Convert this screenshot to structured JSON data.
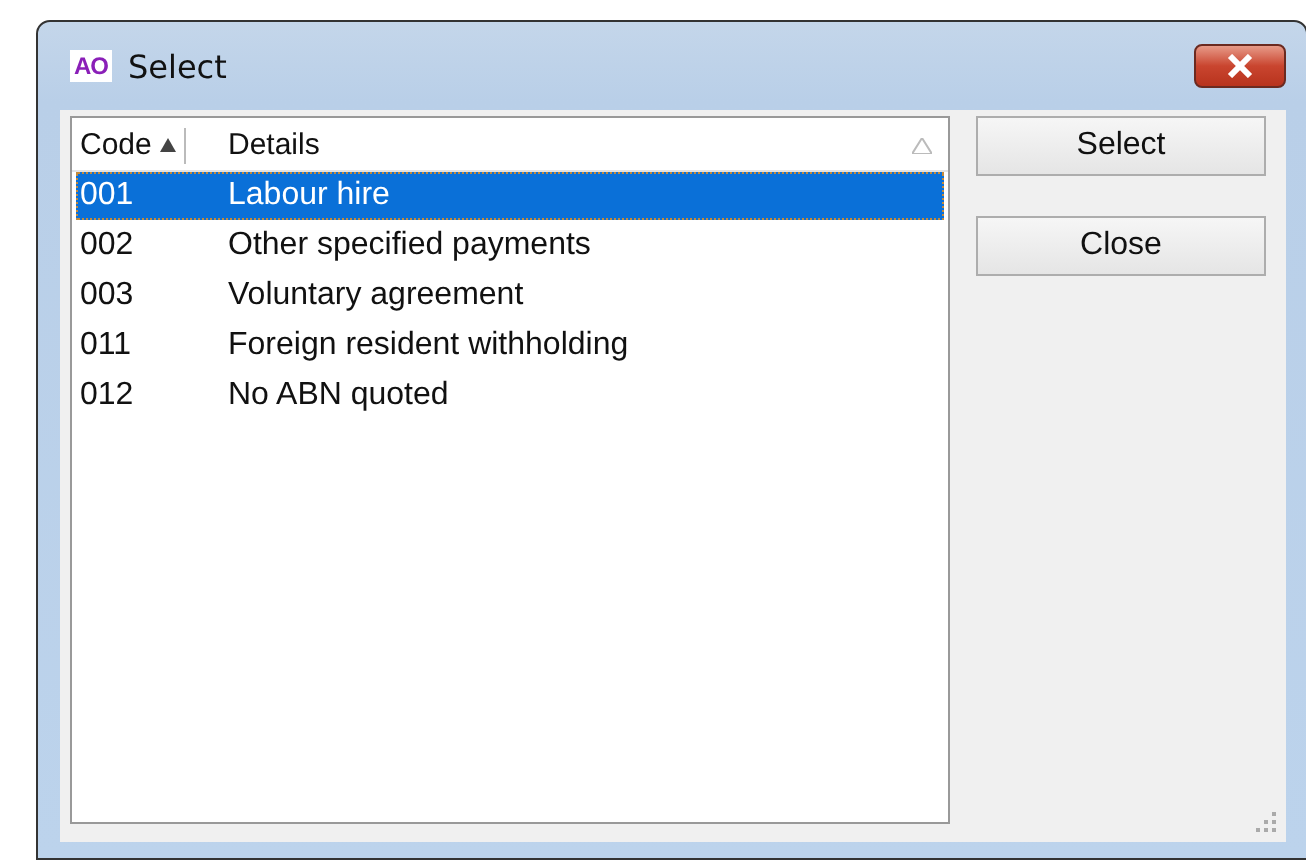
{
  "window": {
    "title": "Select",
    "app_icon": "AO"
  },
  "table": {
    "columns": [
      {
        "label": "Code",
        "sorted": true
      },
      {
        "label": "Details",
        "sorted": false
      }
    ],
    "rows": [
      {
        "cells": [
          "001",
          "Labour hire"
        ],
        "selected": true
      },
      {
        "cells": [
          "002",
          "Other specified payments"
        ],
        "selected": false
      },
      {
        "cells": [
          "003",
          "Voluntary agreement"
        ],
        "selected": false
      },
      {
        "cells": [
          "011",
          "Foreign resident withholding"
        ],
        "selected": false
      },
      {
        "cells": [
          "012",
          "No ABN quoted"
        ],
        "selected": false
      }
    ]
  },
  "buttons": [
    "Select",
    "Close"
  ]
}
